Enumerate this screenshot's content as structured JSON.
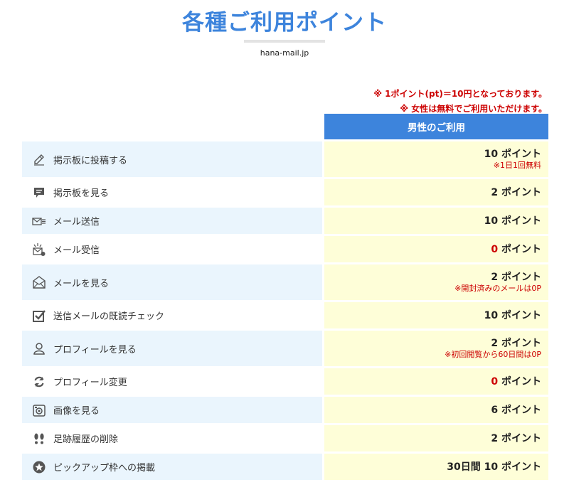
{
  "page": {
    "title": "各種ご利用ポイント",
    "site": "hana-mail.jp"
  },
  "notes": [
    "※ 1ポイント(pt)＝10円となっております。",
    "※ 女性は無料でご利用いただけます。"
  ],
  "table": {
    "column_header": "男性のご利用",
    "rows": [
      {
        "icon": "pencil-icon",
        "action": "掲示板に投稿する",
        "cost_value": "10",
        "cost_unit": " ポイント",
        "note": "※1日1回無料"
      },
      {
        "icon": "speech-bubble-icon",
        "action": "掲示板を見る",
        "cost_value": "2",
        "cost_unit": " ポイント",
        "note": ""
      },
      {
        "icon": "send-mail-icon",
        "action": "メール送信",
        "cost_value": "10",
        "cost_unit": " ポイント",
        "note": ""
      },
      {
        "icon": "receive-mail-icon",
        "action": "メール受信",
        "cost_value": "0",
        "cost_unit": " ポイント",
        "note": ""
      },
      {
        "icon": "open-envelope-icon",
        "action": "メールを見る",
        "cost_value": "2",
        "cost_unit": " ポイント",
        "note": "※開封済みのメールは0P"
      },
      {
        "icon": "checkbox-icon",
        "action": "送信メールの既読チェック",
        "cost_value": "10",
        "cost_unit": " ポイント",
        "note": ""
      },
      {
        "icon": "profile-icon",
        "action": "プロフィールを見る",
        "cost_value": "2",
        "cost_unit": " ポイント",
        "note": "※初回閲覧から60日間は0P"
      },
      {
        "icon": "refresh-icon",
        "action": "プロフィール変更",
        "cost_value": "0",
        "cost_unit": " ポイント",
        "note": ""
      },
      {
        "icon": "camera-icon",
        "action": "画像を見る",
        "cost_value": "6",
        "cost_unit": " ポイント",
        "note": ""
      },
      {
        "icon": "footprints-icon",
        "action": "足跡履歴の削除",
        "cost_value": "2",
        "cost_unit": " ポイント",
        "note": ""
      },
      {
        "icon": "star-icon",
        "action": "ピックアップ枠への掲載",
        "cost_value": "30日間 10",
        "cost_unit": " ポイント",
        "note": ""
      }
    ]
  },
  "colors": {
    "accent": "#3d84dc",
    "note_red": "#cc0000",
    "row_tint": "#eaf5fd",
    "cost_bg": "#fefed8"
  }
}
